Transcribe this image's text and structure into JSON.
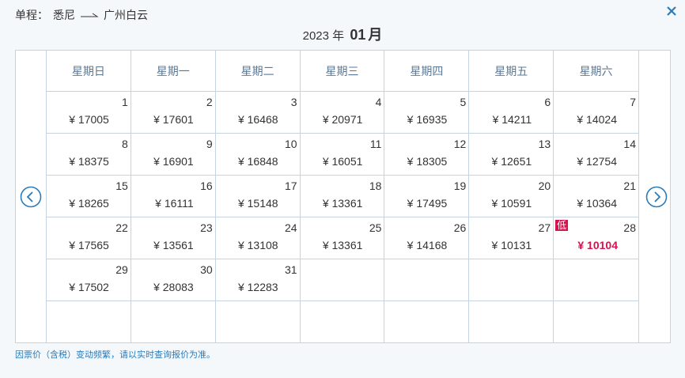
{
  "header": {
    "trip_type": "单程：",
    "from": "悉尼",
    "to": "广州白云"
  },
  "month": {
    "year": "2023",
    "year_suffix": "年",
    "month": "01",
    "month_suffix": "月"
  },
  "weekdays": [
    "星期日",
    "星期一",
    "星期二",
    "星期三",
    "星期四",
    "星期五",
    "星期六"
  ],
  "days": [
    {
      "day": "1",
      "price": "¥ 17005"
    },
    {
      "day": "2",
      "price": "¥ 17601"
    },
    {
      "day": "3",
      "price": "¥ 16468"
    },
    {
      "day": "4",
      "price": "¥ 20971"
    },
    {
      "day": "5",
      "price": "¥ 16935"
    },
    {
      "day": "6",
      "price": "¥ 14211"
    },
    {
      "day": "7",
      "price": "¥ 14024"
    },
    {
      "day": "8",
      "price": "¥ 18375"
    },
    {
      "day": "9",
      "price": "¥ 16901"
    },
    {
      "day": "10",
      "price": "¥ 16848"
    },
    {
      "day": "11",
      "price": "¥ 16051"
    },
    {
      "day": "12",
      "price": "¥ 18305"
    },
    {
      "day": "13",
      "price": "¥ 12651"
    },
    {
      "day": "14",
      "price": "¥ 12754"
    },
    {
      "day": "15",
      "price": "¥ 18265"
    },
    {
      "day": "16",
      "price": "¥ 16111"
    },
    {
      "day": "17",
      "price": "¥ 15148"
    },
    {
      "day": "18",
      "price": "¥ 13361"
    },
    {
      "day": "19",
      "price": "¥ 17495"
    },
    {
      "day": "20",
      "price": "¥ 10591"
    },
    {
      "day": "21",
      "price": "¥ 10364"
    },
    {
      "day": "22",
      "price": "¥ 17565"
    },
    {
      "day": "23",
      "price": "¥ 13561"
    },
    {
      "day": "24",
      "price": "¥ 13108"
    },
    {
      "day": "25",
      "price": "¥ 13361"
    },
    {
      "day": "26",
      "price": "¥ 14168"
    },
    {
      "day": "27",
      "price": "¥ 10131"
    },
    {
      "day": "28",
      "price": "¥ 10104",
      "low": true
    },
    {
      "day": "29",
      "price": "¥ 17502"
    },
    {
      "day": "30",
      "price": "¥ 28083"
    },
    {
      "day": "31",
      "price": "¥ 12283"
    }
  ],
  "low_badge": "低",
  "notice": "因票价（含税）变动频繁，请以实时查询报价为准。",
  "colors": {
    "accent": "#2b7bb9",
    "low_price": "#d6124f",
    "border": "#c5d3e0",
    "weekday_text": "#5a7896"
  },
  "icons": {
    "close": "close-icon",
    "prev": "chevron-left-circle-icon",
    "next": "chevron-right-circle-icon",
    "route_arrow": "arrow-right-icon"
  }
}
